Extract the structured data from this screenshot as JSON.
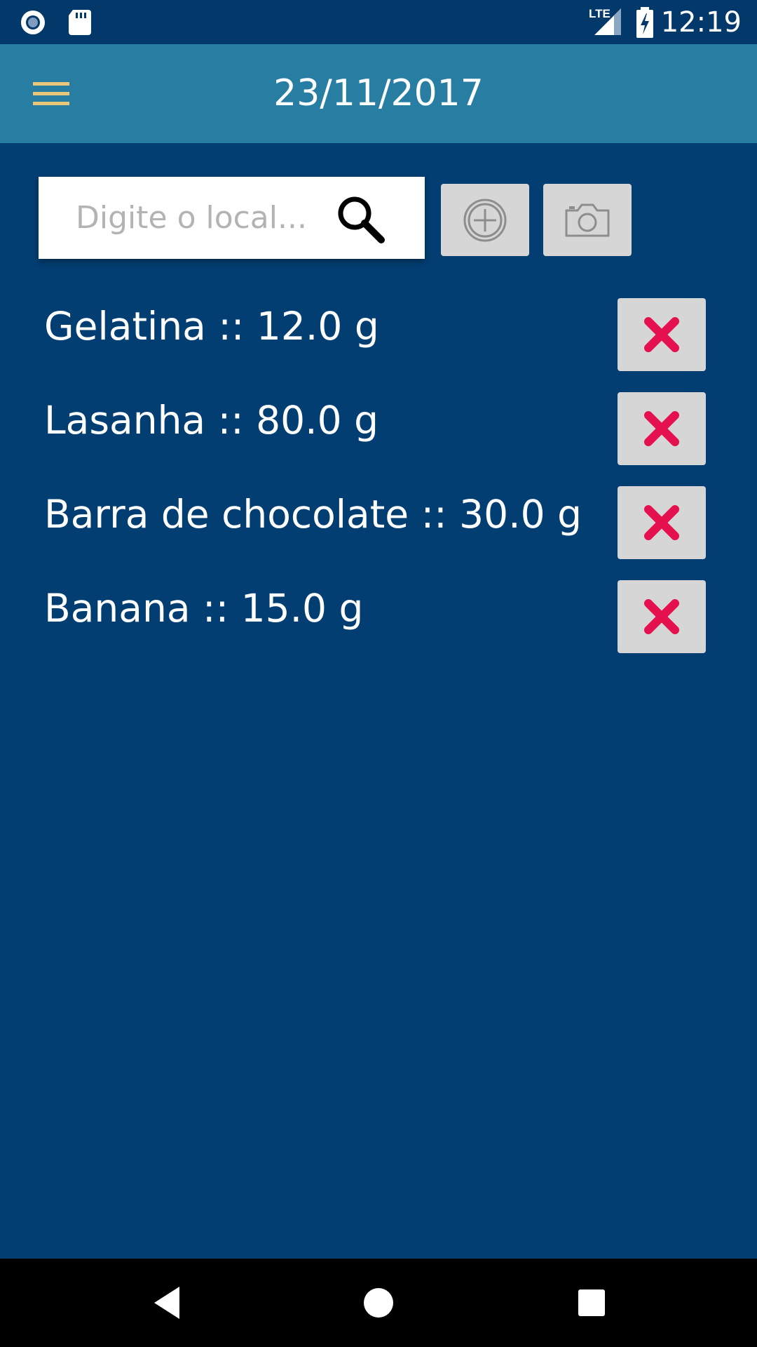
{
  "status_bar": {
    "time": "12:19",
    "network_label": "LTE",
    "left_icons": [
      "record-icon",
      "sd-card-icon"
    ],
    "right_icons": [
      "lte-signal-icon",
      "battery-charging-icon"
    ]
  },
  "app_bar": {
    "title": "23/11/2017",
    "menu_icon": "hamburger-menu-icon",
    "menu_icon_color": "#e8c878",
    "background_color": "#277ea2"
  },
  "search": {
    "placeholder": "Digite o local...",
    "value": "",
    "icon": "search-icon"
  },
  "actions": {
    "add_icon": "add-circle-icon",
    "camera_icon": "camera-icon"
  },
  "food_items": [
    {
      "label": "Gelatina :: 12.0 g"
    },
    {
      "label": "Lasanha :: 80.0 g"
    },
    {
      "label": "Barra de chocolate :: 30.0 g"
    },
    {
      "label": "Banana :: 15.0 g"
    }
  ],
  "delete_icon": "delete-x-icon",
  "delete_icon_color": "#e5104e",
  "nav_bar": {
    "buttons": [
      "back-icon",
      "home-icon",
      "recents-icon"
    ]
  },
  "colors": {
    "background": "#033e72",
    "status_bar": "#02396a",
    "button_gray": "#d6d6d6"
  }
}
